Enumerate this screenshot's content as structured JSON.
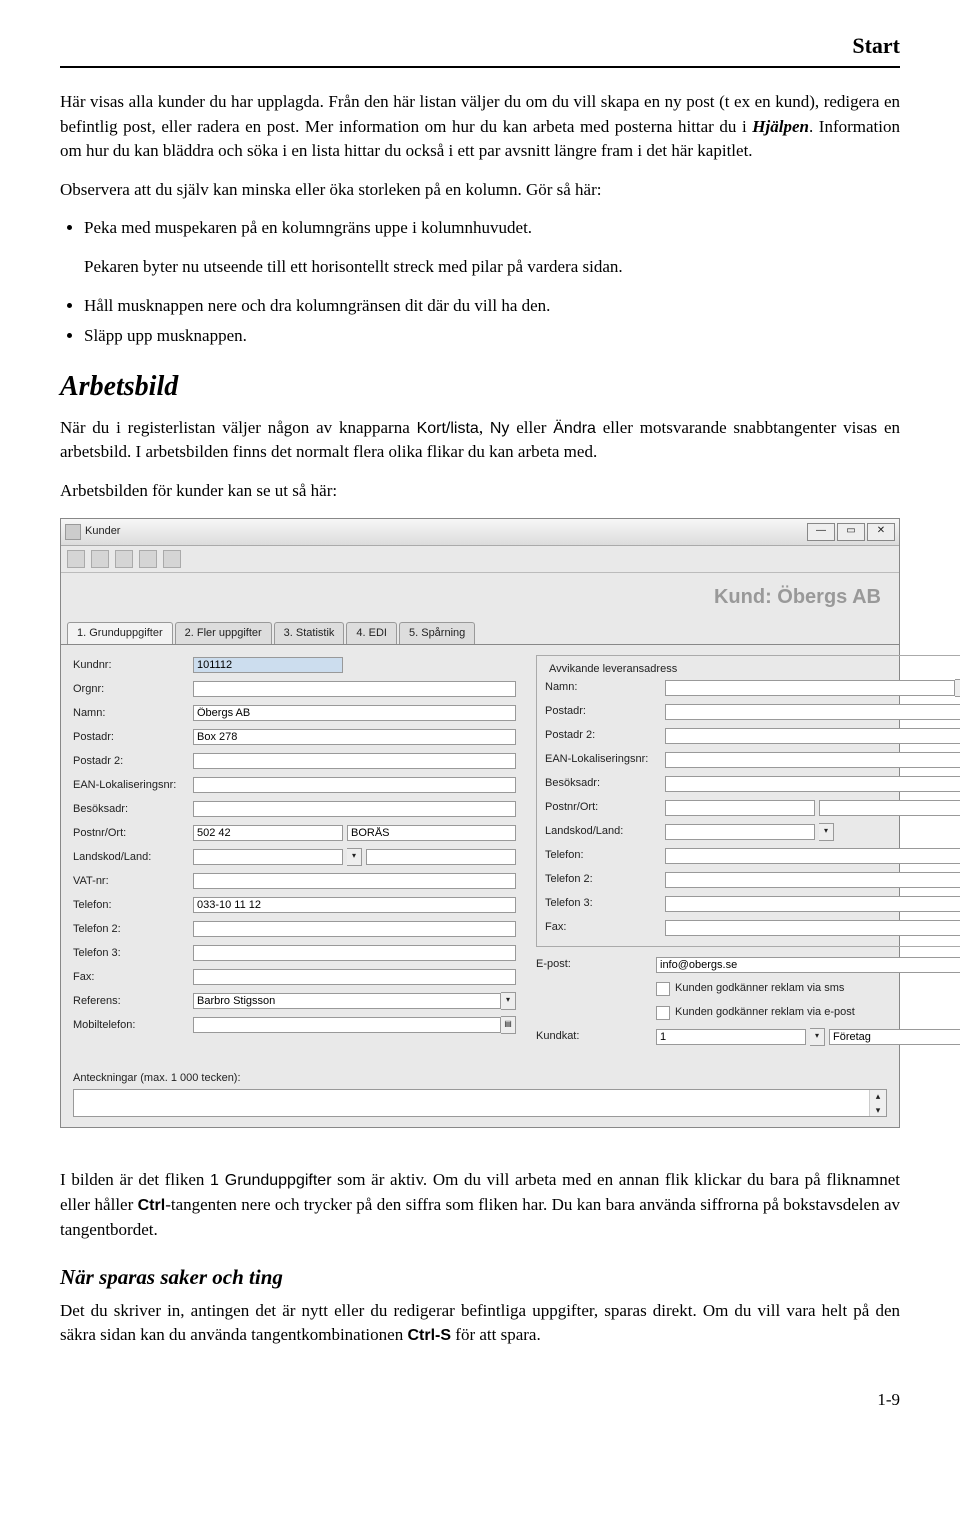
{
  "header": {
    "section": "Start"
  },
  "body": {
    "p1": "Här visas alla kunder du har upplagda. Från den här listan väljer du om du vill skapa en ny post (t ex en kund), redigera en befintlig post, eller radera en post. Mer information om hur du kan arbeta med posterna hittar du i ",
    "p1_link": "Hjälpen",
    "p1_tail": ". Information om hur du kan bläddra och söka i en lista hittar du också i ett par avsnitt längre fram i det här kapitlet.",
    "p2": "Observera att du själv kan minska eller öka storleken på en kolumn. Gör så här:",
    "b1": "Peka med muspekaren på en kolumngräns uppe i kolumnhuvudet.",
    "p3": "Pekaren byter nu utseende till ett horisontellt streck med pilar på vardera sidan.",
    "b2": "Håll musknappen nere och dra kolumngränsen dit där du vill ha den.",
    "b3": "Släpp upp musknappen.",
    "h_arbetsbild": "Arbetsbild",
    "p4a": "När du i registerlistan väljer någon av knapparna ",
    "p4_k1": "Kort/lista",
    "p4b": ", ",
    "p4_k2": "Ny",
    "p4c": " eller ",
    "p4_k3": "Ändra",
    "p4d": " eller motsvarande snabbtangenter visas en arbetsbild. I arbetsbilden finns det normalt flera olika flikar du kan arbeta med.",
    "p5": "Arbetsbilden för kunder kan se ut så här:",
    "p6a": "I bilden är det fliken ",
    "p6_k": "1 Grunduppgifter",
    "p6b": " som är aktiv. Om du vill arbeta med en annan flik klickar du bara på fliknamnet eller håller ",
    "p6_ctrl": "Ctrl",
    "p6c": "-tangenten nere och trycker på den siffra som fliken har. Du kan bara använda siffrorna på bokstavsdelen av tangentbordet.",
    "h_spara": "När sparas saker och ting",
    "p7a": "Det du skriver in, antingen det är nytt eller du redigerar befintliga uppgifter, sparas direkt. Om du vill vara helt på den säkra sidan kan du använda tangentkombinationen ",
    "p7_ctrls": "Ctrl-S",
    "p7b": " för att spara.",
    "pagenum": "1-9"
  },
  "app": {
    "title": "Kunder",
    "banner": "Kund: Öbergs AB",
    "tabs": [
      "1. Grunduppgifter",
      "2. Fler uppgifter",
      "3. Statistik",
      "4. EDI",
      "5. Spårning"
    ],
    "left_labels": {
      "kundnr": "Kundnr:",
      "orgnr": "Orgnr:",
      "namn": "Namn:",
      "postadr": "Postadr:",
      "postadr2": "Postadr 2:",
      "ean": "EAN-Lokaliseringsnr:",
      "besok": "Besöksadr:",
      "postnrort": "Postnr/Ort:",
      "landskod": "Landskod/Land:",
      "vat": "VAT-nr:",
      "tel": "Telefon:",
      "tel2": "Telefon 2:",
      "tel3": "Telefon 3:",
      "fax": "Fax:",
      "referens": "Referens:",
      "mobil": "Mobiltelefon:"
    },
    "left_values": {
      "kundnr": "101112",
      "namn": "Öbergs AB",
      "postadr": "Box 278",
      "postnr": "502 42",
      "ort": "BORÅS",
      "tel": "033-10 11 12",
      "referens": "Barbro Stigsson"
    },
    "right": {
      "legend": "Avvikande leveransadress",
      "namn": "Namn:",
      "postadr": "Postadr:",
      "postadr2": "Postadr 2:",
      "ean": "EAN-Lokaliseringsnr:",
      "besok": "Besöksadr:",
      "postnrort": "Postnr/Ort:",
      "landskod": "Landskod/Land:",
      "tel": "Telefon:",
      "tel2": "Telefon 2:",
      "tel3": "Telefon 3:",
      "fax": "Fax:",
      "epost": "E-post:",
      "epost_val": "info@obergs.se",
      "chk_sms": "Kunden godkänner reklam via sms",
      "chk_epost": "Kunden godkänner reklam via e-post",
      "kundkat": "Kundkat:",
      "kundkat_num": "1",
      "kundkat_val": "Företag"
    },
    "anteck_label": "Anteckningar (max. 1 000 tecken):"
  }
}
